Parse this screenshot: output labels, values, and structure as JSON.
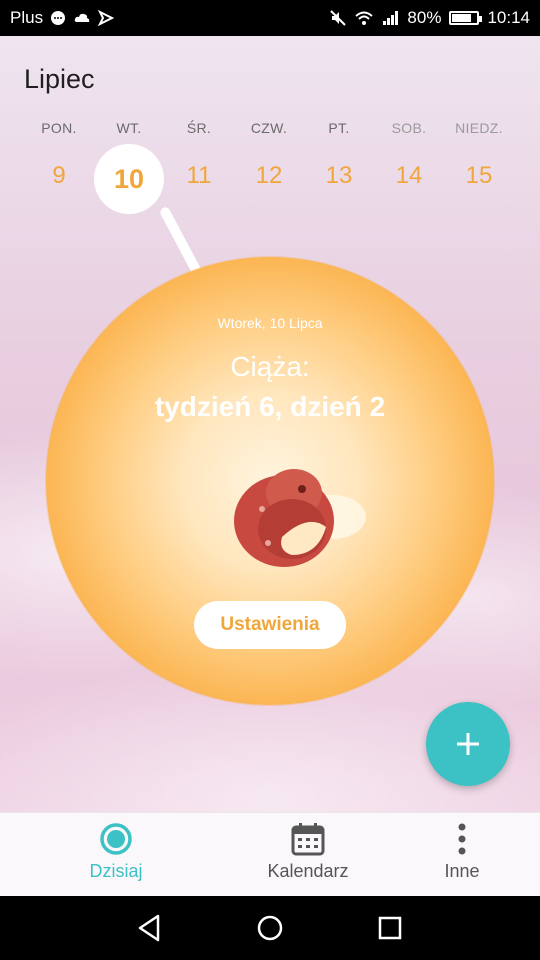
{
  "status_bar": {
    "carrier": "Plus",
    "battery": "80%",
    "battery_level": 0.8,
    "time": "10:14"
  },
  "calendar": {
    "month": "Lipiec",
    "days": [
      {
        "name": "PON.",
        "date": "9"
      },
      {
        "name": "WT.",
        "date": "10",
        "selected": true
      },
      {
        "name": "ŚR.",
        "date": "11"
      },
      {
        "name": "CZW.",
        "date": "12"
      },
      {
        "name": "PT.",
        "date": "13"
      },
      {
        "name": "SOB.",
        "date": "14"
      },
      {
        "name": "NIEDZ.",
        "date": "15"
      }
    ]
  },
  "today_card": {
    "date": "Wtorek, 10 Lipca",
    "title": "Ciąża:",
    "week_line": "tydzień 6, dzień 2",
    "settings_label": "Ustawienia"
  },
  "fab": {
    "icon": "plus-icon"
  },
  "bottom_nav": {
    "items": [
      {
        "label": "Dzisiaj",
        "icon": "today-ring-icon",
        "active": true
      },
      {
        "label": "Kalendarz",
        "icon": "calendar-icon"
      },
      {
        "label": "Inne",
        "icon": "more-vertical-icon"
      }
    ]
  },
  "colors": {
    "accent_orange": "#f0a63a",
    "accent_teal": "#3cc1c4"
  }
}
